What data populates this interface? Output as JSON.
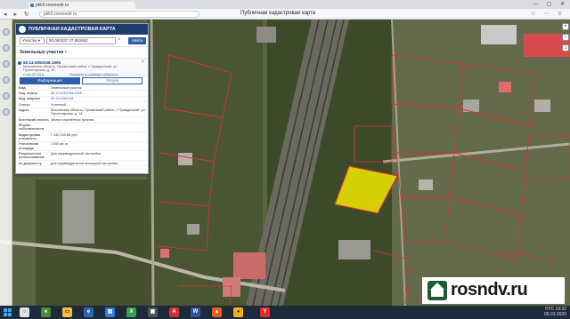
{
  "browser": {
    "tab_title": "pkk5.rosreestr.ru",
    "url": "pkk5.rosreestr.ru",
    "page_title": "Публичная кадастровая карта",
    "window_controls": "— ▢ ✕"
  },
  "panel": {
    "header_title": "ПУБЛИЧНАЯ КАДАСТРОВАЯ КАРТА",
    "search_type": "Участки ▾",
    "search_value": "50,062537 37,862652",
    "search_button": "Найти",
    "section_title": "Земельные участки ⁵",
    "result": {
      "number": "50:13:0050108:1905",
      "address": "Московская область, Пушкинский район, г. Правдинский, ул. Пролетарская, д. 18",
      "link_left": "Ст.рк.ЗУ (1) ▸",
      "link_right": "Показать в границах объекта ▸"
    },
    "tabs": {
      "info": "Информация",
      "services": "Услуги"
    },
    "props": [
      {
        "k": "Вид",
        "v": "Земельный участок",
        "link": false
      },
      {
        "k": "Кад. номер",
        "v": "50:13:0050108:1905",
        "link": true
      },
      {
        "k": "Кад. квартал",
        "v": "50:13:0050108",
        "link": true
      },
      {
        "k": "Статус",
        "v": "Учтенный",
        "link": false
      },
      {
        "k": "Адрес",
        "v": "Московская область, Пушкинский район, г. Правдинский, ул. Пролетарская, д. 18",
        "link": false
      },
      {
        "k": "Категория земель",
        "v": "Земли населённых пунктов",
        "link": false
      },
      {
        "k": "Форма собственности",
        "v": "",
        "link": false
      },
      {
        "k": "Кадастровая стоимость",
        "v": "7 132 153,85 руб.",
        "link": false
      },
      {
        "k": "Уточненная площадь",
        "v": "2 850 кв. м",
        "link": false
      },
      {
        "k": "Разрешенное использование",
        "v": "Для индивидуальной застройки",
        "link": false
      },
      {
        "k": "по документу",
        "v": "для индивидуальной жилищной застройки",
        "link": false
      }
    ]
  },
  "watermark": {
    "brand": "rosndv.ru"
  },
  "taskbar": {
    "time": "19:32",
    "date": "09.03.2020",
    "lang": "РУС"
  },
  "colors": {
    "panel_header": "#1f3c6e",
    "accent": "#2d5fa8",
    "highlight_parcel": "#f2e600",
    "parcel_lines": "#e03030"
  }
}
